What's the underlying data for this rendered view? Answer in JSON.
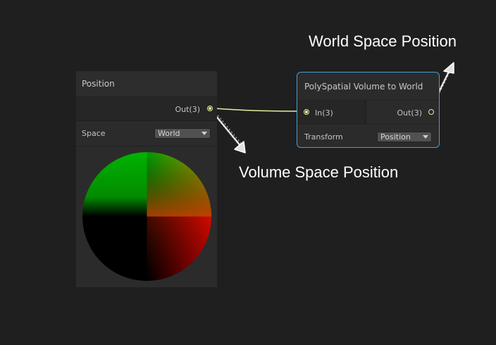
{
  "annotations": {
    "world_space": "World Space Position",
    "volume_space": "Volume Space Position"
  },
  "position_node": {
    "title": "Position",
    "output_port": "Out(3)",
    "space_label": "Space",
    "space_value": "World"
  },
  "poly_node": {
    "title": "PolySpatial Volume to World",
    "input_port": "In(3)",
    "output_port": "Out(3)",
    "transform_label": "Transform",
    "transform_value": "Position"
  },
  "colors": {
    "background": "#1f1f1f",
    "node_body": "#2b2b2b",
    "selected_border": "#44a0d8",
    "wire": "#e6ee9c",
    "annotation_arrow": "#ffffff"
  }
}
